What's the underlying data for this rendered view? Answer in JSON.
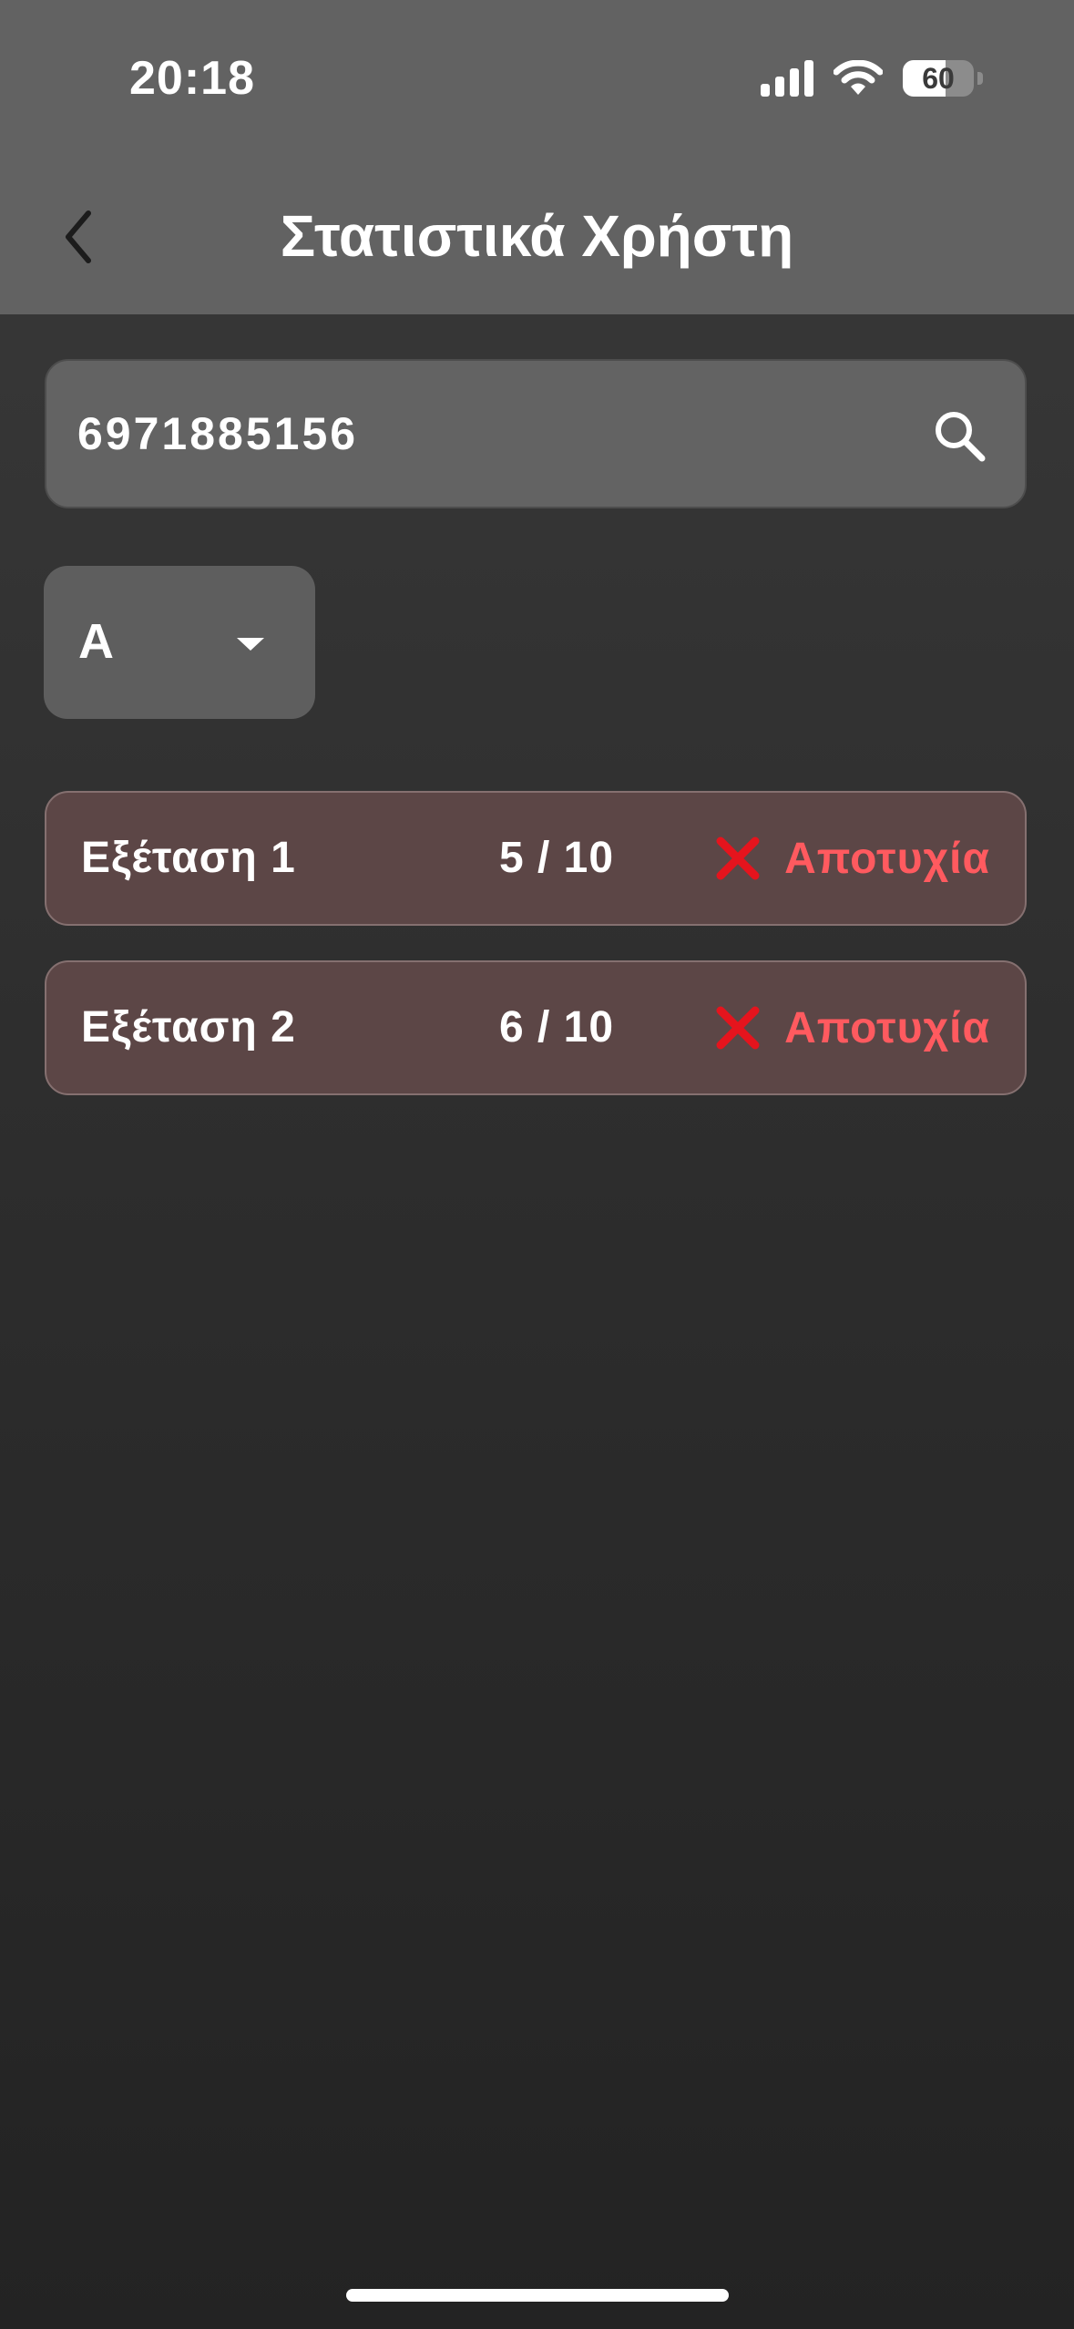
{
  "status_bar": {
    "time": "20:18",
    "battery_level": "60",
    "battery_fraction": 0.6
  },
  "header": {
    "title": "Στατιστικά Χρήστη",
    "background_color": "#626262"
  },
  "search": {
    "value": "6971885156",
    "placeholder": ""
  },
  "filter": {
    "selected": "A"
  },
  "results": [
    {
      "exam": "Εξέταση 1",
      "score": "5 / 10",
      "status": "Αποτυχία"
    },
    {
      "exam": "Εξέταση 2",
      "score": "6 / 10",
      "status": "Αποτυχία"
    }
  ],
  "colors": {
    "fail_text": "#ff5a5f",
    "fail_icon": "#e5141d",
    "row_background": "#5c4646"
  },
  "icons": {
    "back": "chevron-left-icon",
    "search": "search-icon",
    "dropdown": "caret-down-icon",
    "fail": "x-mark-icon",
    "signal": "cellular-signal-icon",
    "wifi": "wifi-icon",
    "battery": "battery-icon"
  }
}
